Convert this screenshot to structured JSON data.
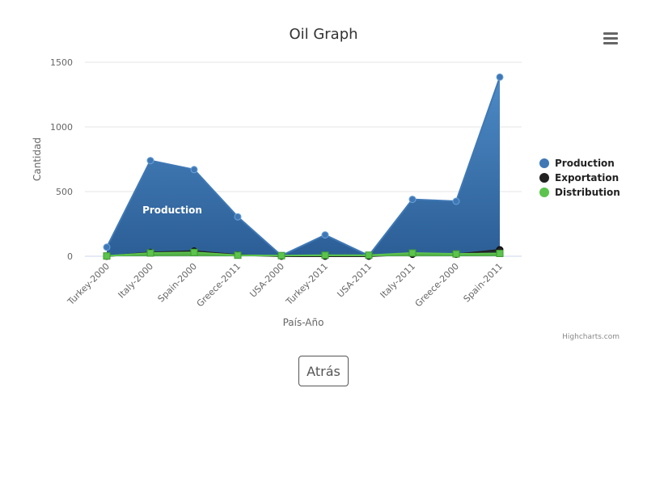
{
  "chart_data": {
    "type": "area",
    "title": "Oil Graph",
    "xlabel": "País-Año",
    "ylabel": "Cantidad",
    "categories": [
      "Turkey-2000",
      "Italy-2000",
      "Spain-2000",
      "Greece-2011",
      "USA-2000",
      "Turkey-2011",
      "USA-2011",
      "Italy-2011",
      "Greece-2000",
      "Spain-2011"
    ],
    "ylim": [
      0,
      1500
    ],
    "yticks": [
      0,
      500,
      1000,
      1500
    ],
    "grid": true,
    "legend_position": "right",
    "series": [
      {
        "name": "Production",
        "color": "#3f78b5",
        "marker": "circle",
        "values": [
          70,
          740,
          670,
          305,
          5,
          165,
          5,
          440,
          425,
          1385
        ]
      },
      {
        "name": "Exportation",
        "color": "#222222",
        "marker": "circle",
        "values": [
          0,
          30,
          40,
          10,
          0,
          0,
          0,
          15,
          15,
          50
        ]
      },
      {
        "name": "Distribution",
        "color": "#5cc34d",
        "marker": "square",
        "values": [
          2,
          25,
          30,
          8,
          5,
          8,
          8,
          25,
          18,
          22
        ]
      }
    ],
    "data_label": "Production",
    "credits": "Highcharts.com"
  },
  "ui": {
    "back_label": "Atrás",
    "menu_icon": "hamburger-menu-icon"
  }
}
